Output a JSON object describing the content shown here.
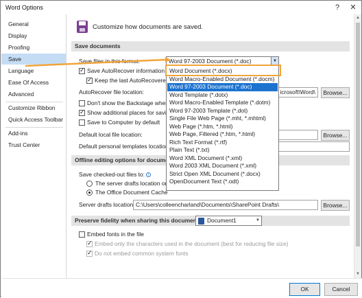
{
  "window": {
    "title": "Word Options",
    "help": "?",
    "close": "✕"
  },
  "sidebar": {
    "items": [
      "General",
      "Display",
      "Proofing",
      "Save",
      "Language",
      "Ease Of Access",
      "Advanced",
      "Customize Ribbon",
      "Quick Access Toolbar",
      "Add-ins",
      "Trust Center"
    ],
    "active_index": 3
  },
  "header": {
    "text": "Customize how documents are saved."
  },
  "save_section": {
    "title": "Save documents",
    "format_label": "Save files in this format:",
    "format_value": "Word 97-2003 Document (*.doc)",
    "autorecover_label": "Save AutoRecover information ev",
    "keep_last_label": "Keep the last AutoRecovered v",
    "autorecover_location_label": "AutoRecover file location:",
    "autorecover_location_value": "icrosoft\\Word\\",
    "dont_show_backstage_label": "Don't show the Backstage when op",
    "show_additional_label": "Show additional places for saving,",
    "save_to_computer_label": "Save to Computer by default",
    "default_local_label": "Default local file location:",
    "default_templates_label": "Default personal templates location:",
    "browse": "Browse..."
  },
  "format_dropdown": {
    "options": [
      "Word Document (*.docx)",
      "Word Macro-Enabled Document (*.docm)",
      "Word 97-2003 Document (*.doc)",
      "Word Template (*.dotx)",
      "Word Macro-Enabled Template (*.dotm)",
      "Word 97-2003 Template (*.dot)",
      "Single File Web Page (*.mht, *.mhtml)",
      "Web Page (*.htm, *.html)",
      "Web Page, Filtered (*.htm, *.html)",
      "Rich Text Format (*.rtf)",
      "Plain Text (*.txt)",
      "Word XML Document (*.xml)",
      "Word 2003 XML Document (*.xml)",
      "Strict Open XML Document (*.docx)",
      "OpenDocument Text (*.odt)"
    ],
    "selected_index": 2,
    "highlighted_index": 0
  },
  "offline_section": {
    "title": "Offline editing options for document",
    "checked_out_label": "Save checked-out files to:",
    "server_drafts_label": "The server drafts location on th",
    "office_cache_label": "The Office Document Cache",
    "server_drafts_location_label": "Server drafts location:",
    "server_drafts_location_value": "C:\\Users\\colleencharland\\Documents\\SharePoint Drafts\\",
    "browse": "Browse..."
  },
  "fidelity_section": {
    "title": "Preserve fidelity when sharing this document:",
    "document_value": "Document1",
    "embed_fonts_label": "Embed fonts in the file",
    "embed_only_label": "Embed only the characters used in the document (best for reducing file size)",
    "do_not_embed_label": "Do not embed common system fonts"
  },
  "footer": {
    "ok": "OK",
    "cancel": "Cancel"
  },
  "colors": {
    "highlight_orange": "#f0a43a",
    "selection_blue": "#1c73cf",
    "sidebar_active": "#c5ddf4",
    "save_icon_purple": "#7b3f8f"
  }
}
